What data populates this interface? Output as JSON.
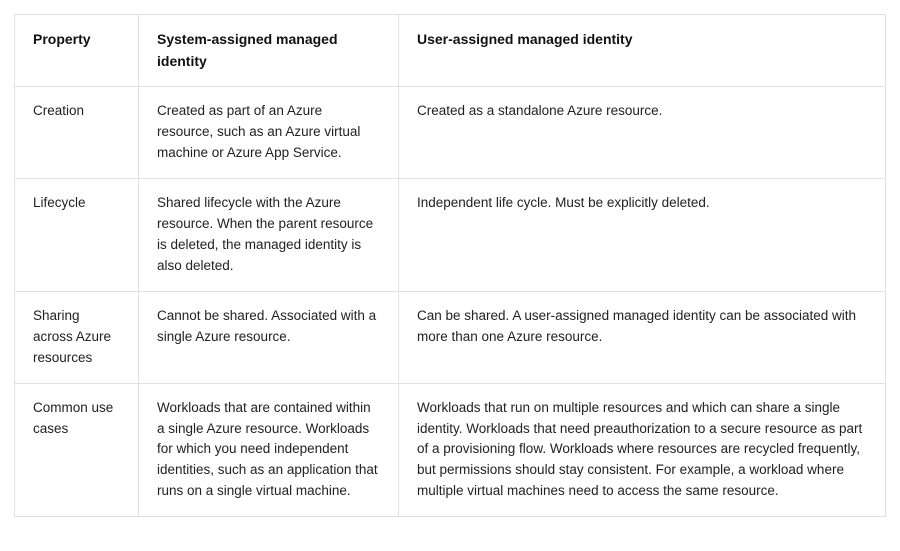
{
  "table": {
    "headers": {
      "property": "Property",
      "system": "System-assigned managed identity",
      "user": "User-assigned managed identity"
    },
    "rows": [
      {
        "property": "Creation",
        "system": "Created as part of an Azure resource, such as an Azure virtual machine or Azure App Service.",
        "user": "Created as a standalone Azure resource."
      },
      {
        "property": "Lifecycle",
        "system": "Shared lifecycle with the Azure resource. When the parent resource is deleted, the managed identity is also deleted.",
        "user": "Independent life cycle. Must be explicitly deleted."
      },
      {
        "property": "Sharing across Azure resources",
        "system": "Cannot be shared. Associated with a single Azure resource.",
        "user": "Can be shared. A user-assigned managed identity can be associated with more than one Azure resource."
      },
      {
        "property": "Common use cases",
        "system": "Workloads that are contained within a single Azure resource. Workloads for which you need independent identities, such as an application that runs on a single virtual machine.",
        "user": "Workloads that run on multiple resources and which can share a single identity. Workloads that need preauthorization to a secure resource as part of a provisioning flow. Workloads where resources are recycled frequently, but permissions should stay consistent. For example, a workload where multiple virtual machines need to access the same resource."
      }
    ]
  }
}
